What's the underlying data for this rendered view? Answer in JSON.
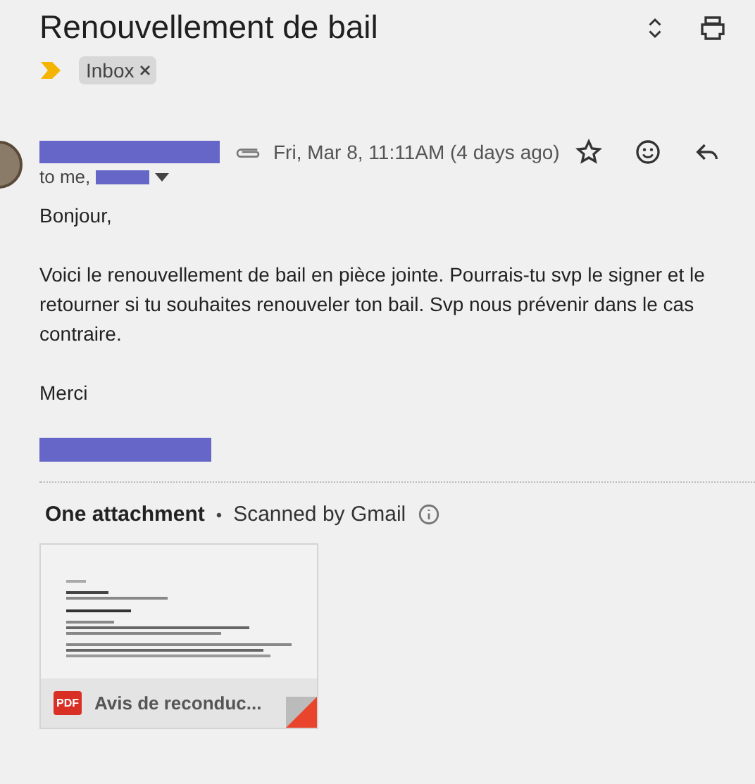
{
  "subject": "Renouvellement de bail",
  "labels": [
    {
      "text": "Inbox"
    }
  ],
  "message": {
    "date": "Fri, Mar 8, 11:11AM (4 days ago)",
    "recipient_prefix": "to me,",
    "starred": false,
    "body": [
      "Bonjour,",
      "Voici le renouvellement de bail en pièce jointe. Pourrais-tu svp le signer et le retourner si tu souhaites renouveler ton bail. Svp nous prévenir dans le cas contraire.",
      "Merci"
    ]
  },
  "attachments": {
    "heading": "One attachment",
    "separator": "•",
    "scan_note": "Scanned by Gmail",
    "files": [
      {
        "type_badge": "PDF",
        "name": "Avis de reconduc..."
      }
    ]
  }
}
